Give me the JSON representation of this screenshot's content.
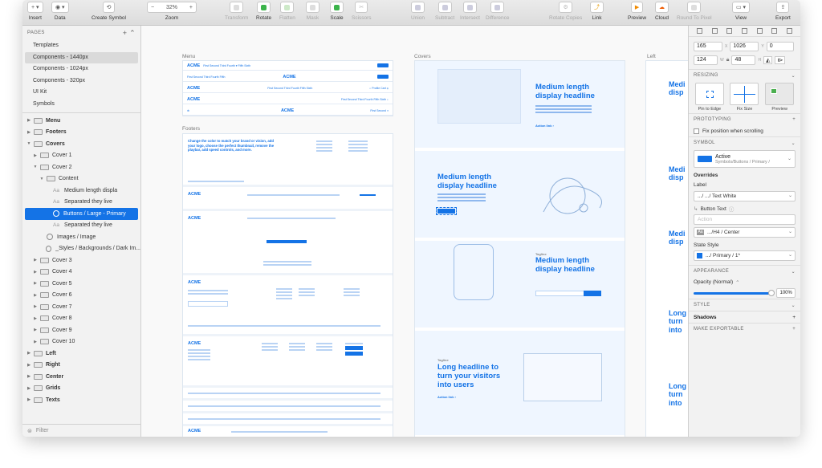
{
  "toolbar": {
    "items_left": [
      {
        "label": "Insert",
        "icon": "plus-icon"
      },
      {
        "label": "Data",
        "icon": "data-icon"
      },
      {
        "label": "Create Symbol",
        "icon": "create-symbol-icon"
      }
    ],
    "zoom": {
      "value": "32%",
      "label": "Zoom"
    },
    "items_mid": [
      {
        "label": "Transform",
        "dim": true
      },
      {
        "label": "Rotate",
        "dim": false
      },
      {
        "label": "Flatten",
        "dim": true
      },
      {
        "label": "Mask",
        "dim": true
      },
      {
        "label": "Scale",
        "dim": false
      },
      {
        "label": "Scissors",
        "dim": true
      }
    ],
    "items_bool": [
      {
        "label": "Union"
      },
      {
        "label": "Subtract"
      },
      {
        "label": "Intersect"
      },
      {
        "label": "Difference"
      }
    ],
    "items_right": [
      {
        "label": "Rotate Copies",
        "dim": true
      },
      {
        "label": "Link",
        "dim": false
      },
      {
        "label": "Preview",
        "dim": false
      },
      {
        "label": "Cloud",
        "dim": false
      },
      {
        "label": "Round To Pixel",
        "dim": true
      },
      {
        "label": "View",
        "dim": false
      },
      {
        "label": "Export",
        "dim": false
      }
    ]
  },
  "sidebar": {
    "pages_title": "PAGES",
    "pages": [
      "Templates",
      "Components - 1440px",
      "Components - 1024px",
      "Components - 320px",
      "UI Kit",
      "Symbols"
    ],
    "selected_page": "Components - 1440px",
    "layers": [
      {
        "label": "Menu",
        "type": "group",
        "indent": 0,
        "expanded": false,
        "bold": true
      },
      {
        "label": "Footers",
        "type": "group",
        "indent": 0,
        "expanded": false,
        "bold": true
      },
      {
        "label": "Covers",
        "type": "group",
        "indent": 0,
        "expanded": true,
        "bold": true
      },
      {
        "label": "Cover 1",
        "type": "group",
        "indent": 1,
        "expanded": false
      },
      {
        "label": "Cover 2",
        "type": "group",
        "indent": 1,
        "expanded": true
      },
      {
        "label": "Content",
        "type": "group",
        "indent": 2,
        "expanded": true
      },
      {
        "label": "Medium length displa",
        "type": "text",
        "indent": 3
      },
      {
        "label": "Separated they live",
        "type": "text",
        "indent": 3
      },
      {
        "label": "Buttons / Large - Primary",
        "type": "symbol",
        "indent": 3,
        "selected": true
      },
      {
        "label": "Separated they live",
        "type": "text",
        "indent": 3
      },
      {
        "label": "Images / Image",
        "type": "symbol",
        "indent": 2
      },
      {
        "label": "_Styles / Backgrounds / Dark Im...",
        "type": "symbol",
        "indent": 2
      },
      {
        "label": "Cover 3",
        "type": "group",
        "indent": 1
      },
      {
        "label": "Cover 4",
        "type": "group",
        "indent": 1
      },
      {
        "label": "Cover 5",
        "type": "group",
        "indent": 1
      },
      {
        "label": "Cover 6",
        "type": "group",
        "indent": 1
      },
      {
        "label": "Cover 7",
        "type": "group",
        "indent": 1
      },
      {
        "label": "Cover 8",
        "type": "group",
        "indent": 1
      },
      {
        "label": "Cover 9",
        "type": "group",
        "indent": 1
      },
      {
        "label": "Cover 10",
        "type": "group",
        "indent": 1
      },
      {
        "label": "Left",
        "type": "group",
        "indent": 0,
        "bold": true
      },
      {
        "label": "Right",
        "type": "group",
        "indent": 0,
        "bold": true
      },
      {
        "label": "Center",
        "type": "group",
        "indent": 0,
        "bold": true
      },
      {
        "label": "Grids",
        "type": "group",
        "indent": 0,
        "bold": true
      },
      {
        "label": "Texts",
        "type": "group",
        "indent": 0,
        "bold": true
      }
    ],
    "filter_placeholder": "Filter"
  },
  "canvas": {
    "artboard_labels": {
      "menu": "Menu",
      "footers": "Footers",
      "covers": "Covers",
      "left": "Left"
    },
    "logo": "ACME",
    "footer_text": "Change the color to match your brand or vision, add your logo, choose the perfect thumbnail, remove the playbar, add speed controls, and more.",
    "cover_headlines": [
      "Medium length display headline",
      "Medium length display headline",
      "Medium length display headline",
      "Long headline to turn your visitors into users"
    ],
    "tagline": "Tagline",
    "action_link": "Action link  ›",
    "left_headlines": [
      "Medi disp",
      "Medi disp",
      "Medi disp",
      "Long turn into",
      "Long turn into"
    ]
  },
  "inspector": {
    "x": "165",
    "y": "1026",
    "rotation": "0",
    "w": "124",
    "h": "48",
    "labels": {
      "x": "X",
      "y": "Y",
      "w": "W",
      "h": "H"
    },
    "resizing_title": "RESIZING",
    "resize_options": [
      "Pin to Edge",
      "Fix Size",
      "Preview"
    ],
    "prototyping_title": "PROTOTYPING",
    "fix_position": "Fix position when scrolling",
    "symbol_title": "SYMBOL",
    "symbol_name": "Active",
    "symbol_path": "Symbols/Buttons / Primary /",
    "overrides_title": "Overrides",
    "label_title": "Label",
    "label_value": ".../ .../ Text White",
    "button_text_title": "Button Text",
    "button_text_placeholder": "Action",
    "text_style_value": ".../H4 / Center",
    "state_style_title": "State Style",
    "state_style_value": ".../ Primary / 1*",
    "appearance_title": "APPEARANCE",
    "opacity_label": "Opacity (Normal)",
    "opacity_value": "100%",
    "opacity_fraction": 1.0,
    "style_title": "STYLE",
    "shadows_title": "Shadows",
    "make_exportable_title": "MAKE EXPORTABLE",
    "accent": "#1473e6"
  }
}
